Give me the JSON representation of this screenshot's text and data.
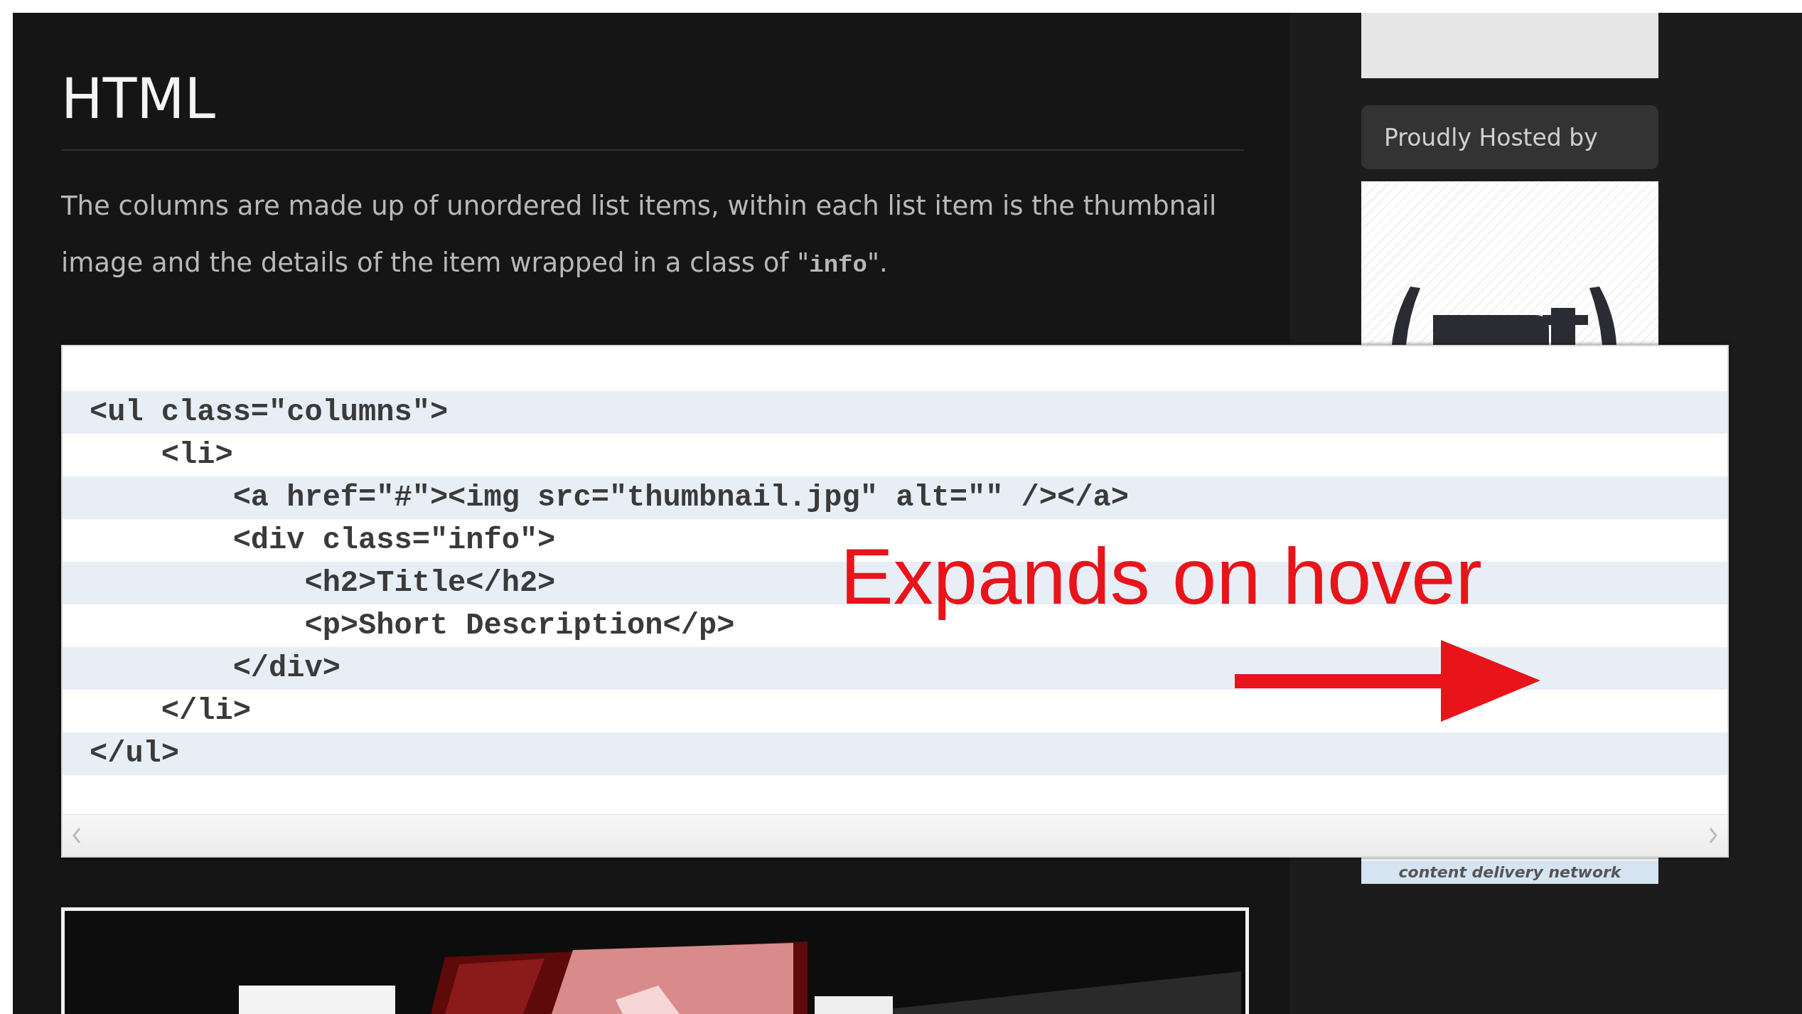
{
  "article": {
    "heading": "HTML",
    "paragraph": [
      {
        "kind": "plain",
        "text": "The columns are made up of unordered list items, within each list item is the thumbnail image and the details of the item wrapped in a class of \""
      },
      {
        "kind": "code",
        "text": "info"
      },
      {
        "kind": "plain",
        "text": "\"."
      }
    ],
    "code_block": {
      "lines": [
        "<ul class=\"columns\">",
        "    <li>",
        "        <a href=\"#\"><img src=\"thumbnail.jpg\" alt=\"\" /></a>",
        "        <div class=\"info\">",
        "            <h2>Title</h2>",
        "            <p>Short Description</p>",
        "        </div>",
        "    </li>",
        "</ul>"
      ]
    },
    "annotation": {
      "text": "Expands on hover"
    }
  },
  "sidebar": {
    "hosted_label": "Proudly Hosted by",
    "logo": {
      "tagline": "content delivery network"
    }
  }
}
